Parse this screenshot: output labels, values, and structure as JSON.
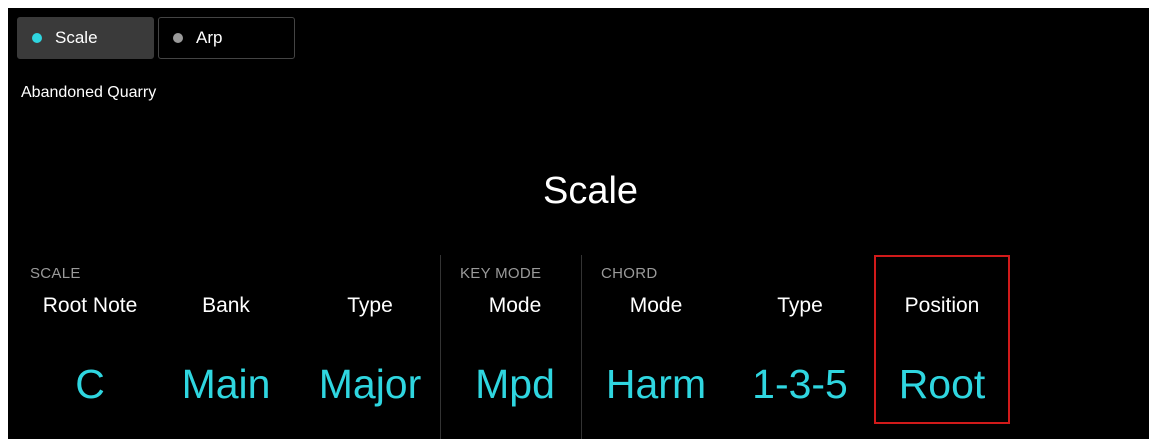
{
  "tabs": [
    {
      "label": "Scale",
      "active": true,
      "dot_color": "#2fd6e0",
      "icon": "status-dot-icon"
    },
    {
      "label": "Arp",
      "active": false,
      "dot_color": "#9a9a9a",
      "icon": "status-dot-icon"
    }
  ],
  "preset_name": "Abandoned Quarry",
  "page_title": "Scale",
  "groups": {
    "scale": "SCALE",
    "key_mode": "KEY MODE",
    "chord": "CHORD"
  },
  "params": [
    {
      "label": "Root Note",
      "value": "C"
    },
    {
      "label": "Bank",
      "value": "Main"
    },
    {
      "label": "Type",
      "value": "Major"
    },
    {
      "label": "Mode",
      "value": "Mpd"
    },
    {
      "label": "Mode",
      "value": "Harm"
    },
    {
      "label": "Type",
      "value": "1-3-5"
    },
    {
      "label": "Position",
      "value": "Root",
      "highlighted": true
    }
  ],
  "colors": {
    "accent": "#2fd6e0",
    "background": "#000000",
    "highlight_border": "#d11a1a"
  }
}
